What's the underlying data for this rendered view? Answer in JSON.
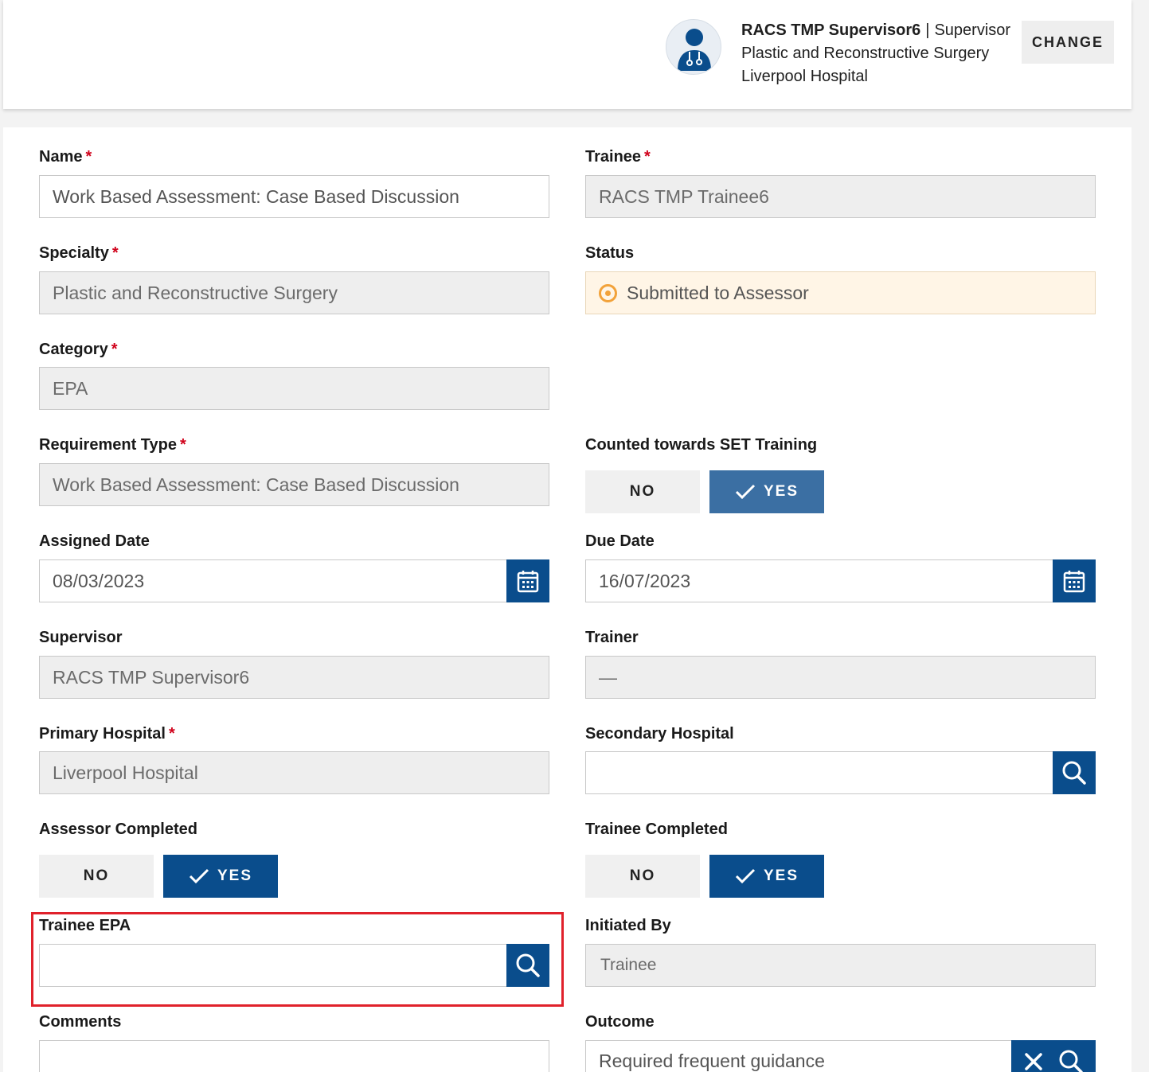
{
  "header": {
    "user_name": "RACS TMP Supervisor6",
    "separator": "|",
    "role": "Supervisor",
    "specialty": "Plastic and Reconstructive Surgery",
    "hospital": "Liverpool Hospital",
    "change_label": "CHANGE",
    "avatar_icon": "doctor-icon"
  },
  "form": {
    "name": {
      "label": "Name",
      "required": "*",
      "value": "Work Based Assessment: Case Based Discussion"
    },
    "trainee": {
      "label": "Trainee",
      "required": "*",
      "value": "RACS TMP Trainee6"
    },
    "specialty": {
      "label": "Specialty",
      "required": "*",
      "value": "Plastic and Reconstructive Surgery"
    },
    "status": {
      "label": "Status",
      "value": "Submitted to Assessor",
      "color": "#f2a23a"
    },
    "category": {
      "label": "Category",
      "required": "*",
      "value": "EPA"
    },
    "requirement_type": {
      "label": "Requirement Type",
      "required": "*",
      "value": "Work Based Assessment: Case Based Discussion"
    },
    "counted_set": {
      "label": "Counted towards SET Training",
      "no": "NO",
      "yes": "YES",
      "selected": "YES"
    },
    "assigned_date": {
      "label": "Assigned Date",
      "value": "08/03/2023"
    },
    "due_date": {
      "label": "Due Date",
      "value": "16/07/2023"
    },
    "supervisor": {
      "label": "Supervisor",
      "value": "RACS TMP Supervisor6"
    },
    "trainer": {
      "label": "Trainer",
      "value": "—"
    },
    "primary_hospital": {
      "label": "Primary Hospital",
      "required": "*",
      "value": "Liverpool Hospital"
    },
    "secondary_hospital": {
      "label": "Secondary Hospital",
      "value": ""
    },
    "assessor_completed": {
      "label": "Assessor Completed",
      "no": "NO",
      "yes": "YES",
      "selected": "YES"
    },
    "trainee_completed": {
      "label": "Trainee Completed",
      "no": "NO",
      "yes": "YES",
      "selected": "YES"
    },
    "trainee_epa": {
      "label": "Trainee EPA",
      "value": ""
    },
    "initiated_by": {
      "label": "Initiated By",
      "value": "Trainee"
    },
    "comments": {
      "label": "Comments",
      "value": ""
    },
    "outcome": {
      "label": "Outcome",
      "value": "Required frequent guidance"
    }
  },
  "colors": {
    "primary": "#0a4d8c",
    "required": "#d0021b",
    "highlight": "#e0212b"
  }
}
